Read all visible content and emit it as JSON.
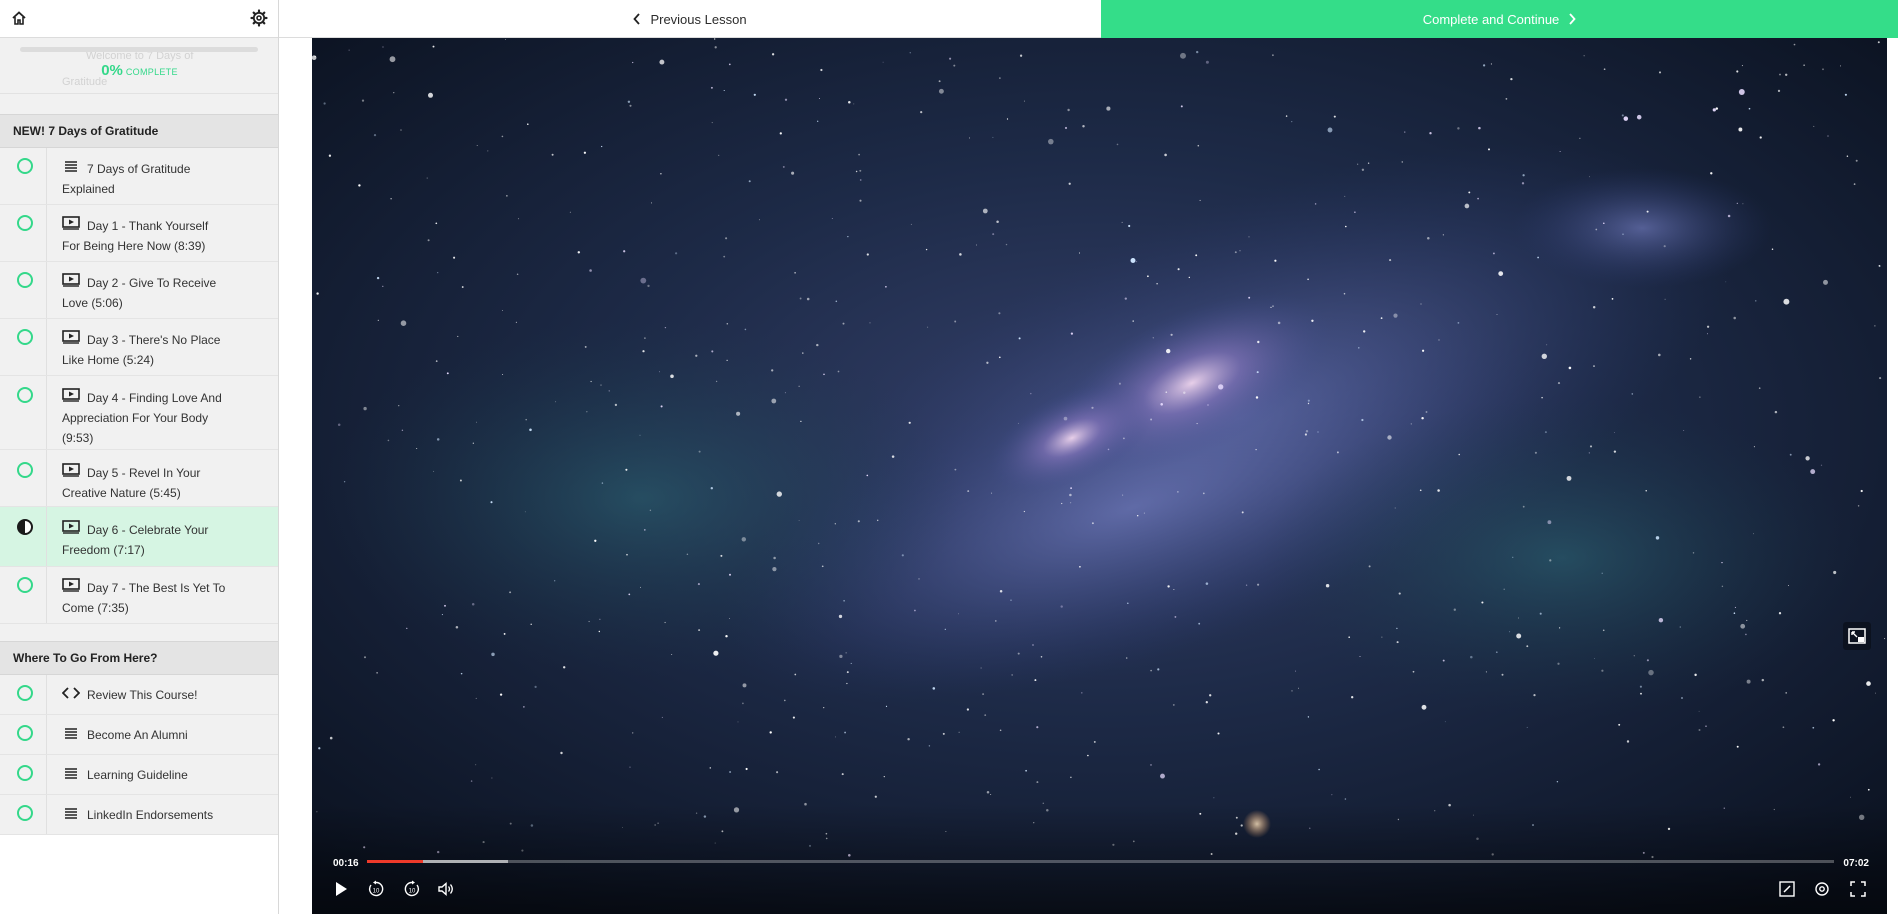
{
  "progress": {
    "percent": "0%",
    "label": "COMPLETE",
    "value": 0
  },
  "sidebar_faded": {
    "line1": "Welcome to 7 Days of",
    "line2": "Gratitude"
  },
  "sections": [
    {
      "title": "NEW! 7 Days of Gratitude",
      "lessons": [
        {
          "icon": "text-icon",
          "title": "7 Days of Gratitude Explained",
          "status": "incomplete"
        },
        {
          "icon": "video-icon",
          "title": "Day 1 - Thank Yourself For Being Here Now (8:39)",
          "status": "incomplete"
        },
        {
          "icon": "video-icon",
          "title": "Day 2 - Give To Receive Love (5:06)",
          "status": "incomplete"
        },
        {
          "icon": "video-icon",
          "title": "Day 3 - There's No Place Like Home (5:24)",
          "status": "incomplete"
        },
        {
          "icon": "video-icon",
          "title": "Day 4 - Finding Love And Appreciation For Your Body (9:53)",
          "status": "incomplete"
        },
        {
          "icon": "video-icon",
          "title": "Day 5 - Revel In Your Creative Nature (5:45)",
          "status": "incomplete"
        },
        {
          "icon": "video-icon",
          "title": "Day 6 - Celebrate Your Freedom (7:17)",
          "status": "in-progress"
        },
        {
          "icon": "video-icon",
          "title": "Day 7 - The Best Is Yet To Come (7:35)",
          "status": "incomplete"
        }
      ]
    },
    {
      "title": "Where To Go From Here?",
      "lessons": [
        {
          "icon": "code-icon",
          "title": "Review This Course!",
          "status": "incomplete"
        },
        {
          "icon": "text-icon",
          "title": "Become An Alumni",
          "status": "incomplete"
        },
        {
          "icon": "text-icon",
          "title": "Learning Guideline",
          "status": "incomplete"
        },
        {
          "icon": "text-icon",
          "title": "LinkedIn Endorsements",
          "status": "incomplete"
        }
      ]
    }
  ],
  "topbar": {
    "previous_label": "Previous Lesson",
    "complete_label": "Complete and Continue"
  },
  "video": {
    "current_time": "00:16",
    "duration": "07:02",
    "played_fraction": 0.038,
    "buffered_fraction": 0.096
  },
  "colors": {
    "accent": "#34dd89",
    "seek": "#ee3a2a"
  }
}
